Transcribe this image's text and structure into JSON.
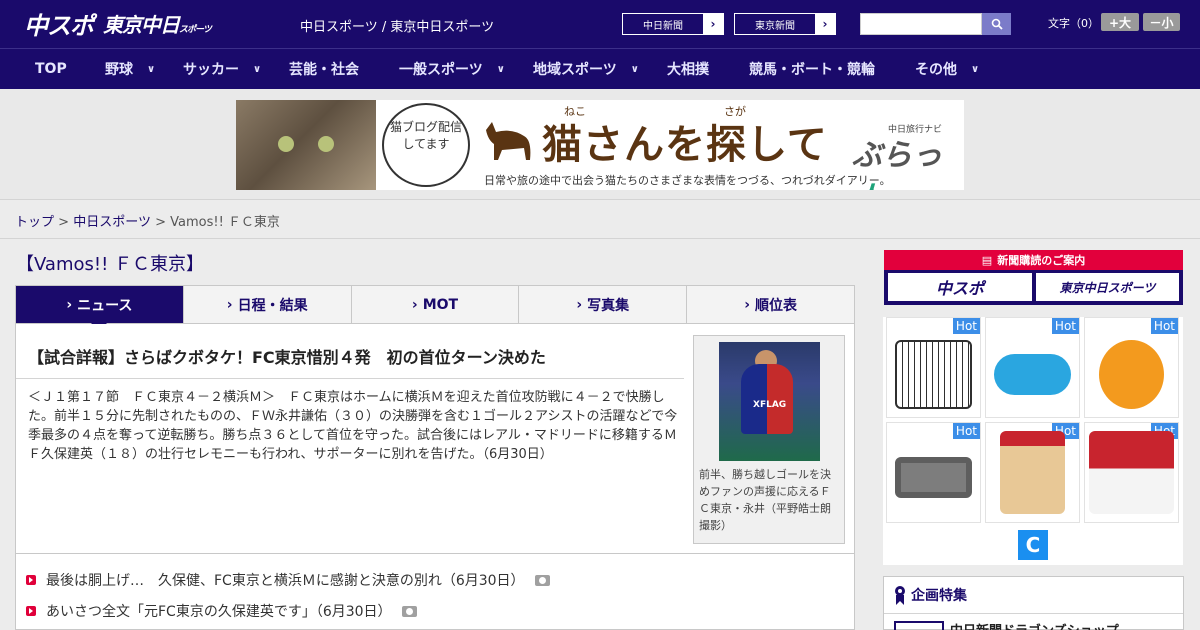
{
  "header": {
    "logo_chuspo": "中スポ",
    "logo_tokyo": "東京中日",
    "logo_tokyo_sub": "スポーツ",
    "site_title": "中日スポーツ / 東京中日スポーツ",
    "paper_links": [
      {
        "label": "中日新聞"
      },
      {
        "label": "東京新聞"
      }
    ],
    "search_placeholder": "",
    "font_label": "文字（0）",
    "font_bigger": "+大",
    "font_smaller": "－小"
  },
  "nav": {
    "items": [
      {
        "label": "TOP",
        "has_menu": false
      },
      {
        "label": "野球",
        "has_menu": true
      },
      {
        "label": "サッカー",
        "has_menu": true
      },
      {
        "label": "芸能・社会",
        "has_menu": false
      },
      {
        "label": "一般スポーツ",
        "has_menu": true
      },
      {
        "label": "地域スポーツ",
        "has_menu": true
      },
      {
        "label": "大相撲",
        "has_menu": false
      },
      {
        "label": "競馬・ボート・競輪",
        "has_menu": false
      },
      {
        "label": "その他",
        "has_menu": true
      }
    ]
  },
  "banner": {
    "bubble": "猫ブログ配信してます",
    "ruby_1": "ねこ",
    "ruby_2": "さが",
    "headline": "猫さんを探して",
    "navi_label": "中日旅行ナビ",
    "brand": "ぶらっ",
    "brand_accent": "人",
    "subtitle": "日常や旅の途中で出会う猫たちのさまざまな表情をつづる、つれづれダイアリー。"
  },
  "breadcrumb": {
    "items": [
      "トップ",
      "中日スポーツ"
    ],
    "current": "Vamos!! ＦＣ東京",
    "separator": ">"
  },
  "main": {
    "heading": "【Vamos!! ＦＣ東京】",
    "tabs": [
      {
        "label": "ニュース",
        "active": true
      },
      {
        "label": "日程・結果",
        "active": false
      },
      {
        "label": "MOT",
        "active": false
      },
      {
        "label": "写真集",
        "active": false
      },
      {
        "label": "順位表",
        "active": false
      }
    ],
    "article": {
      "title": "【試合詳報】さらばクボタケ！FC東京惜別４発　初の首位ターン決めた",
      "body": "＜Ｊ１第１７節　ＦＣ東京４－２横浜Ｍ＞　ＦＣ東京はホームに横浜Ｍを迎えた首位攻防戦に４－２で快勝した。前半１５分に先制されたものの、ＦＷ永井謙佑（３０）の決勝弾を含む１ゴール２アシストの活躍などで今季最多の４点を奪って逆転勝ち。勝ち点３６として首位を守った。試合後にはレアル・マドリードに移籍するＭＦ久保建英（１８）の壮行セレモニーも行われ、サポーターに別れを告げた。（6月30日）",
      "photo_caption": "前半、勝ち越しゴールを決めファンの声援に応えるＦＣ東京・永井（平野皓士朗撮影）",
      "photo_jersey": "XFLAG"
    },
    "news": [
      {
        "text": "最後は胴上げ…　久保健、FC東京と横浜Ｍに感謝と決意の別れ（6月30日）"
      },
      {
        "text": "あいさつ全文「元FC東京の久保建英です」（6月30日）"
      }
    ]
  },
  "sidebar": {
    "subscribe_head": "新聞購読のご案内",
    "subscribe_chuspo": "中スポ",
    "subscribe_tokyo": "東京中日スポーツ",
    "ad_hot_label": "Hot",
    "ad_info": "i",
    "ad_close": "✕",
    "ad_logo": "C",
    "ad_tiles": [
      {
        "icon": "dog-crate-icon",
        "color": "#2f2f2f"
      },
      {
        "icon": "cat-toy-car-icon",
        "color": "#2aa6e0"
      },
      {
        "icon": "cat-toy-tower-icon",
        "color": "#f39a1e"
      },
      {
        "icon": "pet-bed-icon",
        "color": "#7d7d7d"
      },
      {
        "icon": "dog-treat-jar-icon",
        "color": "#c8242e"
      },
      {
        "icon": "antiseptic-wipes-icon",
        "color": "#c8242e"
      }
    ],
    "feature_title": "企画特集",
    "feature_item": "中日新聞ドラゴンズショップ"
  }
}
